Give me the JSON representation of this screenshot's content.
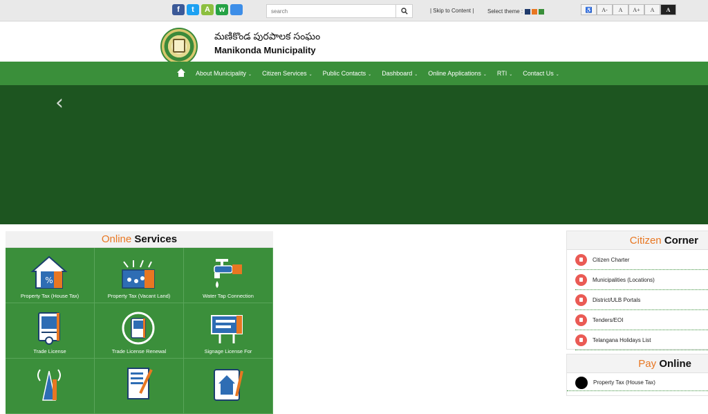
{
  "topbar": {
    "social": [
      {
        "icon": "facebook-icon",
        "glyph": "f",
        "color": "#3b5998"
      },
      {
        "icon": "twitter-icon",
        "glyph": "t",
        "color": "#1da1f2"
      },
      {
        "icon": "android-icon",
        "glyph": "A",
        "color": "#8cbf3f"
      },
      {
        "icon": "whatsapp-icon",
        "glyph": "w",
        "color": "#25a244"
      },
      {
        "icon": "apple-icon",
        "glyph": "",
        "color": "#3d8ee8"
      }
    ],
    "search_placeholder": "search",
    "skip_label": "| Skip to Content |",
    "theme_label": "Select theme :",
    "theme_colors": [
      "#1f3a6b",
      "#e87722",
      "#3a8f3a"
    ],
    "access": [
      {
        "label": "♿",
        "name": "accessibility-icon"
      },
      {
        "label": "A-",
        "name": "font-decrease-button"
      },
      {
        "label": "A",
        "name": "font-normal-button"
      },
      {
        "label": "A+",
        "name": "font-increase-button"
      },
      {
        "label": "A",
        "name": "contrast-light-button"
      },
      {
        "label": "A",
        "name": "contrast-dark-button"
      }
    ]
  },
  "header": {
    "title_telugu": "మణికొండ పురపాలక సంఘం",
    "title_en": "Manikonda Municipality"
  },
  "nav": {
    "items": [
      "About Municipality",
      "Citizen Services",
      "Public Contacts",
      "Dashboard",
      "Online Applications",
      "RTI",
      "Contact Us"
    ],
    "caret": "⌄"
  },
  "banner": {
    "prev": "‹"
  },
  "services": {
    "title_highlight": "Online",
    "title_bold": "Services",
    "tiles": [
      {
        "label": "Property Tax (House Tax)",
        "icon": "house-tax-icon"
      },
      {
        "label": "Property Tax (Vacant Land)",
        "icon": "vacant-land-icon"
      },
      {
        "label": "Water Tap Connection",
        "icon": "water-tap-icon"
      },
      {
        "label": "Trade License",
        "icon": "trade-license-icon"
      },
      {
        "label": "Trade License Renewal",
        "icon": "trade-license-renewal-icon"
      },
      {
        "label": "Signage License For",
        "icon": "signage-license-icon"
      },
      {
        "label": "",
        "icon": "tower-icon"
      },
      {
        "label": "",
        "icon": "building-permission-icon"
      },
      {
        "label": "",
        "icon": "layout-icon"
      }
    ]
  },
  "citizen_corner": {
    "title_highlight": "Citizen",
    "title_bold": "Corner",
    "items": [
      "Citizen Charter",
      "Municipalities (Locations)",
      "District/ULB Portals",
      "Tenders/EOI",
      "Telangana Holidays List"
    ]
  },
  "pay_online": {
    "title_highlight": "Pay",
    "title_bold": "Online",
    "items": [
      "Property Tax (House Tax)"
    ]
  }
}
